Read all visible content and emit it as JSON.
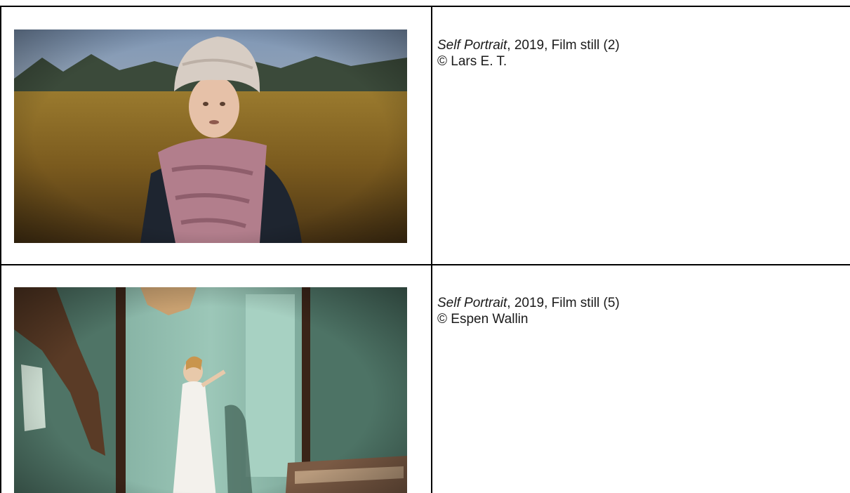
{
  "rows": [
    {
      "image_alt": "Film still of a woman in a knit hat and pink scarf standing in a golden field",
      "caption_title": "Self Portrait",
      "caption_rest": ", 2019, Film still (2)",
      "credit": "© Lars E. T."
    },
    {
      "image_alt": "Film still of a girl in a white dress inside a green, crumbling room",
      "caption_title": "Self Portrait",
      "caption_rest": ", 2019, Film still (5)",
      "credit": "© Espen Wallin"
    }
  ]
}
